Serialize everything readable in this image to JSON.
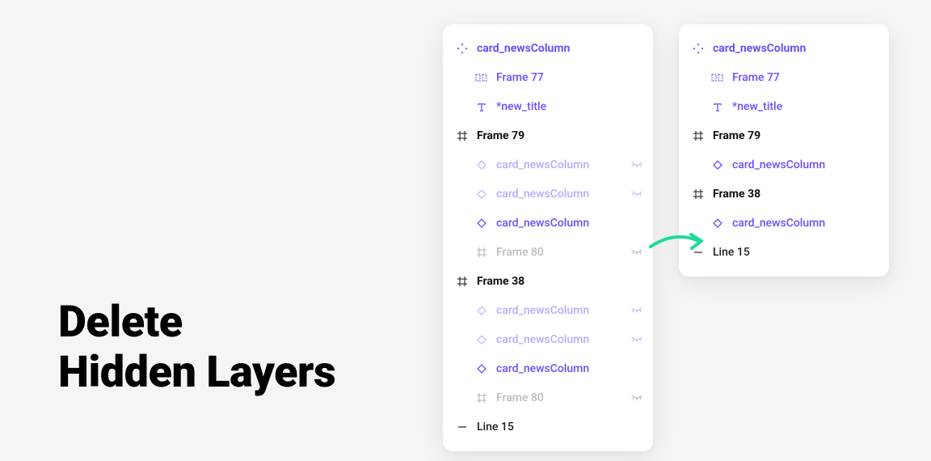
{
  "title_line1": "Delete",
  "title_line2": "Hidden Layers",
  "panel_left": {
    "layers": [
      {
        "icon": "component",
        "label": "card_newsColumn",
        "style": "purple-bold",
        "indent": 0,
        "hidden": false
      },
      {
        "icon": "instance-frame",
        "label": "Frame 77",
        "style": "purple",
        "indent": 1,
        "hidden": false
      },
      {
        "icon": "text",
        "label": "*new_title",
        "style": "purple",
        "indent": 1,
        "hidden": false
      },
      {
        "icon": "frame",
        "label": "Frame 79",
        "style": "black-bold",
        "indent": 0,
        "hidden": false
      },
      {
        "icon": "diamond",
        "label": "card_newsColumn",
        "style": "purple-faded",
        "indent": 2,
        "hidden": true
      },
      {
        "icon": "diamond",
        "label": "card_newsColumn",
        "style": "purple-faded",
        "indent": 2,
        "hidden": true
      },
      {
        "icon": "diamond",
        "label": "card_newsColumn",
        "style": "purple",
        "indent": 2,
        "hidden": false
      },
      {
        "icon": "frame",
        "label": "Frame 80",
        "style": "gray-faded",
        "indent": 2,
        "hidden": true
      },
      {
        "icon": "frame",
        "label": "Frame 38",
        "style": "black-bold",
        "indent": 0,
        "hidden": false
      },
      {
        "icon": "diamond",
        "label": "card_newsColumn",
        "style": "purple-faded",
        "indent": 2,
        "hidden": true
      },
      {
        "icon": "diamond",
        "label": "card_newsColumn",
        "style": "purple-faded",
        "indent": 2,
        "hidden": true
      },
      {
        "icon": "diamond",
        "label": "card_newsColumn",
        "style": "purple",
        "indent": 2,
        "hidden": false
      },
      {
        "icon": "frame",
        "label": "Frame 80",
        "style": "gray-faded",
        "indent": 2,
        "hidden": true
      },
      {
        "icon": "line",
        "label": "Line 15",
        "style": "black",
        "indent": 0,
        "hidden": false
      }
    ]
  },
  "panel_right": {
    "layers": [
      {
        "icon": "component",
        "label": "card_newsColumn",
        "style": "purple-bold",
        "indent": 0,
        "hidden": false
      },
      {
        "icon": "instance-frame",
        "label": "Frame 77",
        "style": "purple",
        "indent": 1,
        "hidden": false
      },
      {
        "icon": "text",
        "label": "*new_title",
        "style": "purple",
        "indent": 1,
        "hidden": false
      },
      {
        "icon": "frame",
        "label": "Frame 79",
        "style": "black-bold",
        "indent": 0,
        "hidden": false
      },
      {
        "icon": "diamond",
        "label": "card_newsColumn",
        "style": "purple",
        "indent": 2,
        "hidden": false
      },
      {
        "icon": "frame",
        "label": "Frame 38",
        "style": "black-bold",
        "indent": 0,
        "hidden": false
      },
      {
        "icon": "diamond",
        "label": "card_newsColumn",
        "style": "purple",
        "indent": 2,
        "hidden": false
      },
      {
        "icon": "line",
        "label": "Line 15",
        "style": "black",
        "indent": 0,
        "hidden": false
      }
    ]
  },
  "arrow_color": "#1ED99B"
}
